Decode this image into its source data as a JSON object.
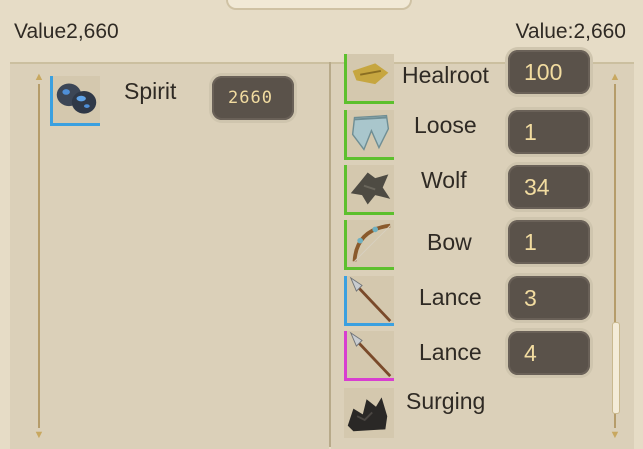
{
  "header": {
    "left_value": "Value2,660",
    "right_value": "Value:2,660"
  },
  "left_panel": {
    "items": [
      {
        "name": "Spirit",
        "count": "2660",
        "rarity_color": "#3aa0e0",
        "icon": "ore-icon"
      }
    ]
  },
  "right_panel": {
    "items": [
      {
        "name": "Healroot",
        "count": "100",
        "rarity_color": "#5dc02e",
        "icon": "herb-icon"
      },
      {
        "name": "Loose",
        "count": "1",
        "rarity_color": "#5dc02e",
        "icon": "pants-icon"
      },
      {
        "name": "Wolf",
        "count": "34",
        "rarity_color": "#5dc02e",
        "icon": "wolf-pelt-icon"
      },
      {
        "name": "Bow",
        "count": "1",
        "rarity_color": "#5dc02e",
        "icon": "bow-icon"
      },
      {
        "name": "Lance",
        "count": "3",
        "rarity_color": "#3aa0e0",
        "icon": "spear-icon"
      },
      {
        "name": "Lance",
        "count": "4",
        "rarity_color": "#d83ed0",
        "icon": "spear-icon"
      },
      {
        "name": "Surging",
        "count": "",
        "rarity_color": "",
        "icon": "coal-icon"
      }
    ]
  }
}
